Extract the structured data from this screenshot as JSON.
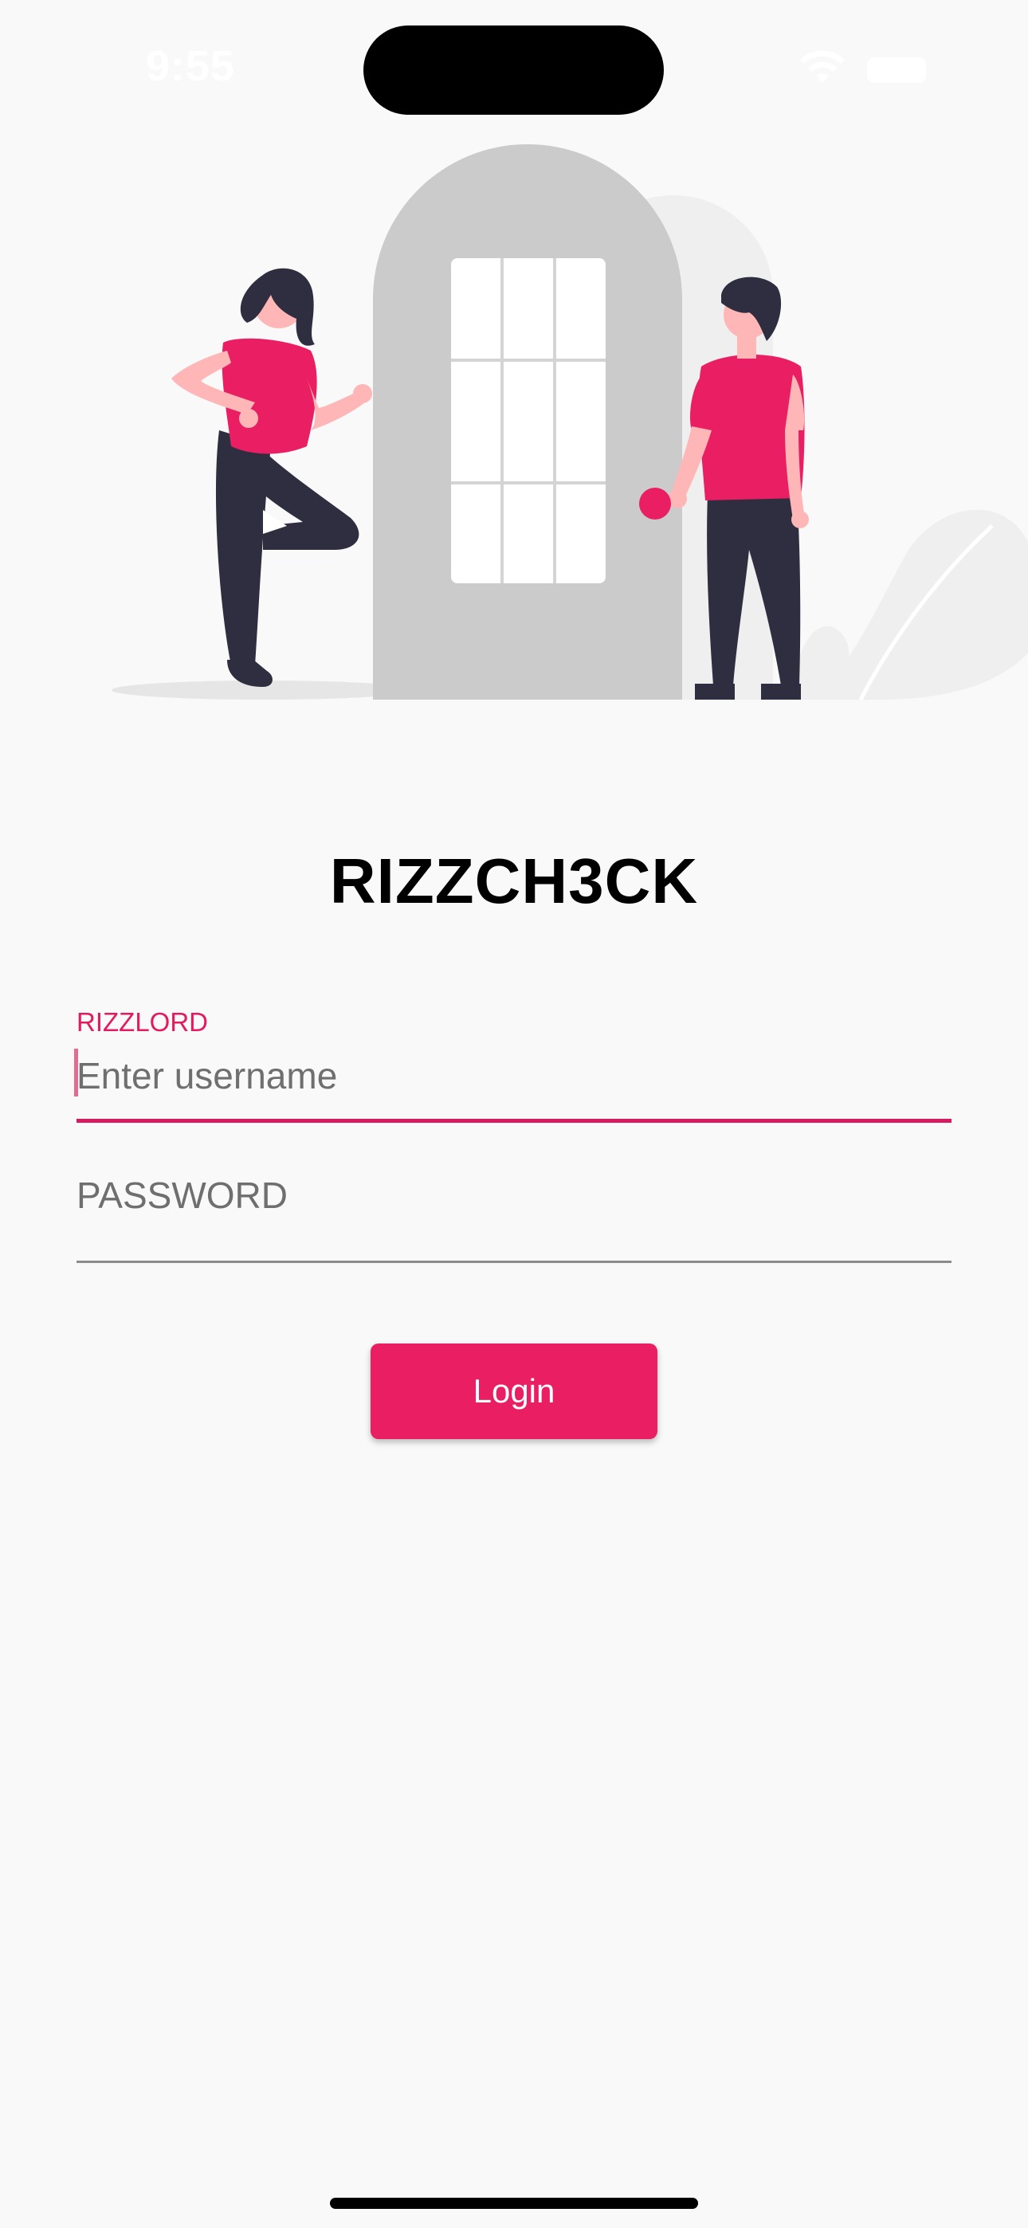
{
  "status_bar": {
    "time": "9:55"
  },
  "app": {
    "title": "RIZZCH3CK"
  },
  "login_form": {
    "username_label": "RIZZLORD",
    "username_value": "",
    "username_placeholder": "Enter username",
    "password_value": "",
    "password_placeholder": "PASSWORD",
    "login_label": "Login"
  },
  "colors": {
    "accent": "#e91e63",
    "background": "#f9f9f9",
    "door": "#cbcbcb",
    "dark_figure": "#2f2e41",
    "skin": "#ffb6b6"
  },
  "icons": {
    "status_wifi": "wifi-icon",
    "status_battery": "battery-icon"
  }
}
